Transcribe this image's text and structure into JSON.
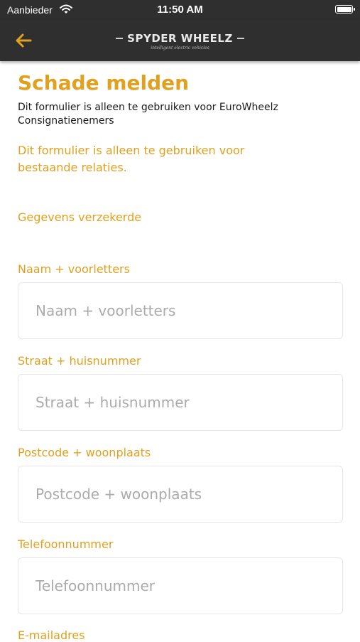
{
  "status_bar": {
    "carrier": "Aanbieder",
    "time": "11:50 AM"
  },
  "nav": {
    "back_icon": "arrow-left-icon",
    "logo_title": "SPYDER WHEELZ",
    "logo_tagline": "intelligent electric vehicles",
    "accent_color": "#e0a020",
    "bar_color": "#2f2f2f"
  },
  "form": {
    "title": "Schade melden",
    "intro": "Dit formulier is alleen te gebruiken voor EuroWheelz Consignatienemers",
    "notice": "Dit formulier is alleen te gebruiken voor bestaande relaties.",
    "section": "Gegevens verzekerde",
    "fields": [
      {
        "label": "Naam + voorletters",
        "placeholder": "Naam + voorletters",
        "value": ""
      },
      {
        "label": "Straat + huisnummer",
        "placeholder": "Straat + huisnummer",
        "value": ""
      },
      {
        "label": "Postcode + woonplaats",
        "placeholder": "Postcode + woonplaats",
        "value": ""
      },
      {
        "label": "Telefoonnummer",
        "placeholder": "Telefoonnummer",
        "value": ""
      },
      {
        "label": "E-mailadres"
      }
    ]
  }
}
